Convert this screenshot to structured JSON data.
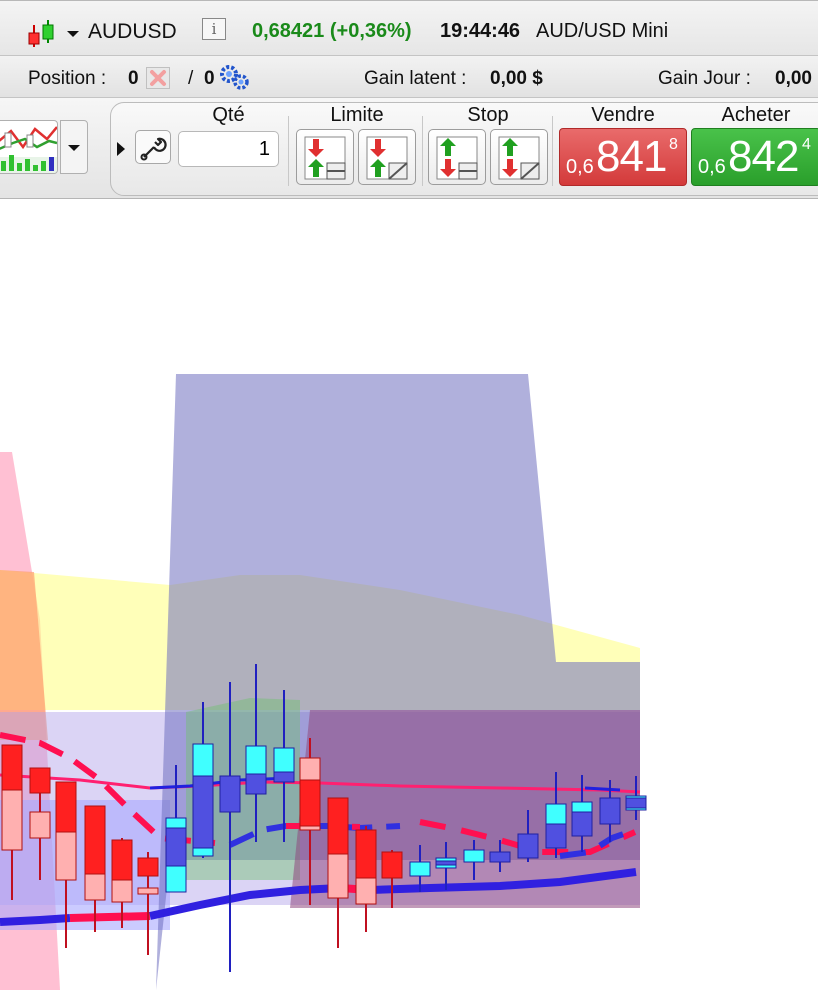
{
  "instrument": {
    "symbol": "AUDUSD",
    "price_change": "0,68421 (+0,36%)",
    "time": "19:44:46",
    "market_name": "AUD/USD Mini",
    "info_glyph": "i"
  },
  "position": {
    "label": "Position :",
    "value": "0",
    "slash": "/",
    "orders": "0",
    "gain_latent_label": "Gain latent :",
    "gain_latent_value": "0,00 $",
    "gain_jour_label": "Gain Jour :",
    "gain_jour_value": "0,00"
  },
  "toolbar": {
    "qty_label": "Qté",
    "qty_value": "1",
    "limit_label": "Limite",
    "stop_label": "Stop",
    "sell_label": "Vendre",
    "buy_label": "Acheter",
    "sell_price": {
      "prefix": "0,6",
      "main": "841",
      "sup": "8"
    },
    "buy_price": {
      "prefix": "0,6",
      "main": "842",
      "sup": "4"
    }
  },
  "colors": {
    "price_up": "#1a8a1a",
    "sell": "#d33a3a",
    "buy": "#2a9f2b",
    "candle_down": "#ff2020",
    "candle_up": "#5050e0",
    "ha_up": "#40ffff",
    "ha_down": "#ffb0b0"
  },
  "icons": {
    "instrument": "candlestick-icon",
    "info": "info-icon",
    "cancel": "cancel-x-icon",
    "orders": "gears-icon",
    "chart_type": "chart-type-icon",
    "tools": "wrench-icon"
  }
}
